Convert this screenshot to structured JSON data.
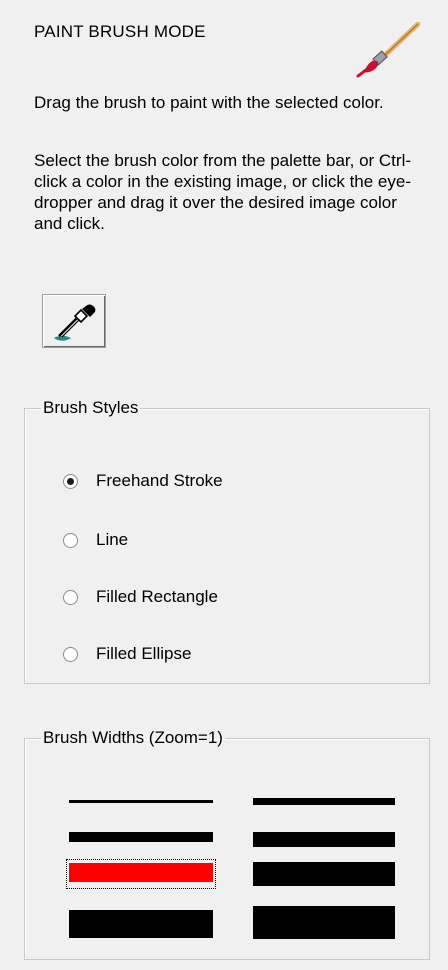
{
  "panel": {
    "title": "PAINT BRUSH MODE",
    "instructions": "Drag the brush to paint with the selected color.",
    "help_text": "Select the brush color from the palette bar, or Ctrl-click a color in the existing image, or click the eye-dropper and drag it over the desired image color and click."
  },
  "brush_styles": {
    "legend": "Brush Styles",
    "options": [
      {
        "label": "Freehand Stroke",
        "checked": true
      },
      {
        "label": "Line",
        "checked": false
      },
      {
        "label": "Filled Rectangle",
        "checked": false
      },
      {
        "label": "Filled Ellipse",
        "checked": false
      }
    ]
  },
  "brush_widths": {
    "legend": "Brush Widths (Zoom=1)",
    "selected_color": "#ff0000",
    "default_color": "#000000"
  }
}
